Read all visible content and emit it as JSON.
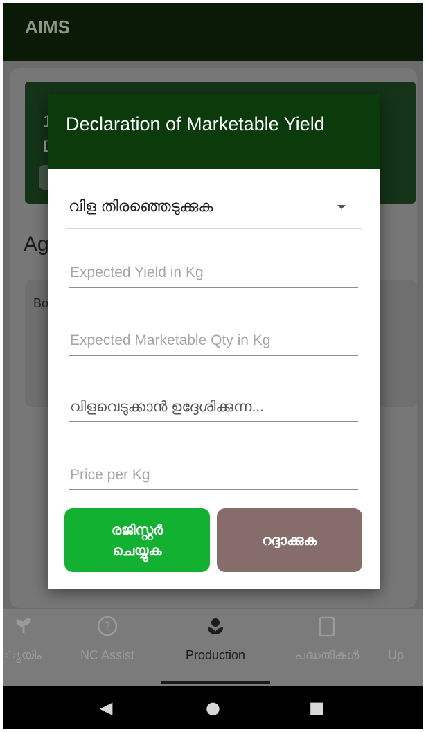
{
  "app": {
    "title": "AIMS"
  },
  "background": {
    "header_line1": "1",
    "header_line2": "D",
    "section_title": "Ag",
    "inner_text": "Bo"
  },
  "dialog": {
    "title": "Declaration of Marketable Yield",
    "crop_select": {
      "label": "വിള തിരഞ്ഞെടുക്കുക"
    },
    "fields": {
      "expected_yield": {
        "placeholder": "Expected Yield in Kg",
        "value": ""
      },
      "expected_marketable": {
        "placeholder": "Expected Marketable Qty in Kg",
        "value": ""
      },
      "harvest_date": {
        "placeholder": "വിളവെടുക്കാൻ ഉദ്ദേശിക്കുന്ന...",
        "value": ""
      },
      "price_per_kg": {
        "placeholder": "Price per Kg",
        "value": ""
      }
    },
    "buttons": {
      "register": "രജിസ്റ്റർ ചെയ്യുക",
      "cancel": "റദ്ദാക്കുക"
    }
  },
  "bottom_nav": {
    "items": [
      {
        "label": "ൃയിം",
        "icon": "sprout-icon"
      },
      {
        "label": "NC Assist",
        "icon": "help-circle-icon"
      },
      {
        "label": "Production",
        "icon": "plant-icon",
        "active": true
      },
      {
        "label": "പദ്ധതികൾ",
        "icon": "clipboard-icon"
      },
      {
        "label": "Up",
        "icon": "upload-icon"
      }
    ]
  },
  "system_nav": {
    "back": "◀",
    "home": "●",
    "recents": "■"
  },
  "colors": {
    "app_bar": "#0b1a06",
    "dialog_header": "#0b3a0b",
    "register_button": "#12b131",
    "cancel_button": "#866d6b"
  }
}
